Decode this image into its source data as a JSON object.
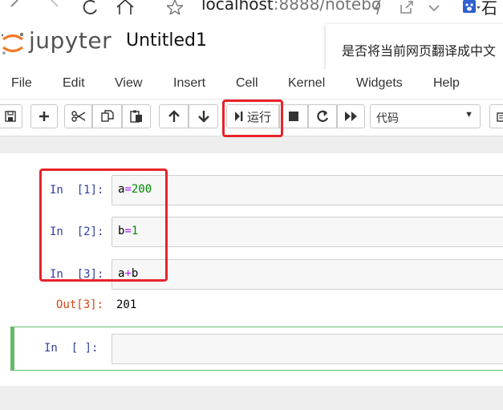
{
  "browser": {
    "url_host": "localhost",
    "url_rest": ":8888/notebo",
    "right_text": "石"
  },
  "header": {
    "logo_text": "jupyter",
    "notebook_title": "Untitled1",
    "translate_prompt": "是否将当前网页翻译成中文"
  },
  "menu": [
    "File",
    "Edit",
    "View",
    "Insert",
    "Cell",
    "Kernel",
    "Widgets",
    "Help"
  ],
  "toolbar": {
    "run_label": "运行",
    "cell_type": "代码"
  },
  "cells": [
    {
      "prompt": "In  [1]:",
      "code_var": "a",
      "code_op": "=",
      "code_val": "200"
    },
    {
      "prompt": "In  [2]:",
      "code_var": "b",
      "code_op": "=",
      "code_val": "1"
    },
    {
      "prompt": "In  [3]:",
      "code_var": "a",
      "code_op": "+",
      "code_val": "b"
    }
  ],
  "output": {
    "prompt": "Out[3]:",
    "value": "201"
  },
  "empty_cell_prompt": "In  [ ]:",
  "colors": {
    "annotation_red": "#e8232a",
    "edit_mode_green": "#66bb6a",
    "in_prompt": "#303f9f",
    "out_prompt": "#d84315"
  },
  "icons": [
    "back-icon",
    "forward-icon",
    "reload-icon",
    "home-icon",
    "star-icon",
    "lightning-icon",
    "share-icon",
    "chevron-down-icon",
    "baidu-paw-icon",
    "save-icon",
    "plus-icon",
    "cut-icon",
    "copy-icon",
    "paste-icon",
    "arrow-up-icon",
    "arrow-down-icon",
    "run-icon",
    "stop-icon",
    "restart-icon",
    "fast-forward-icon",
    "keyboard-icon"
  ]
}
